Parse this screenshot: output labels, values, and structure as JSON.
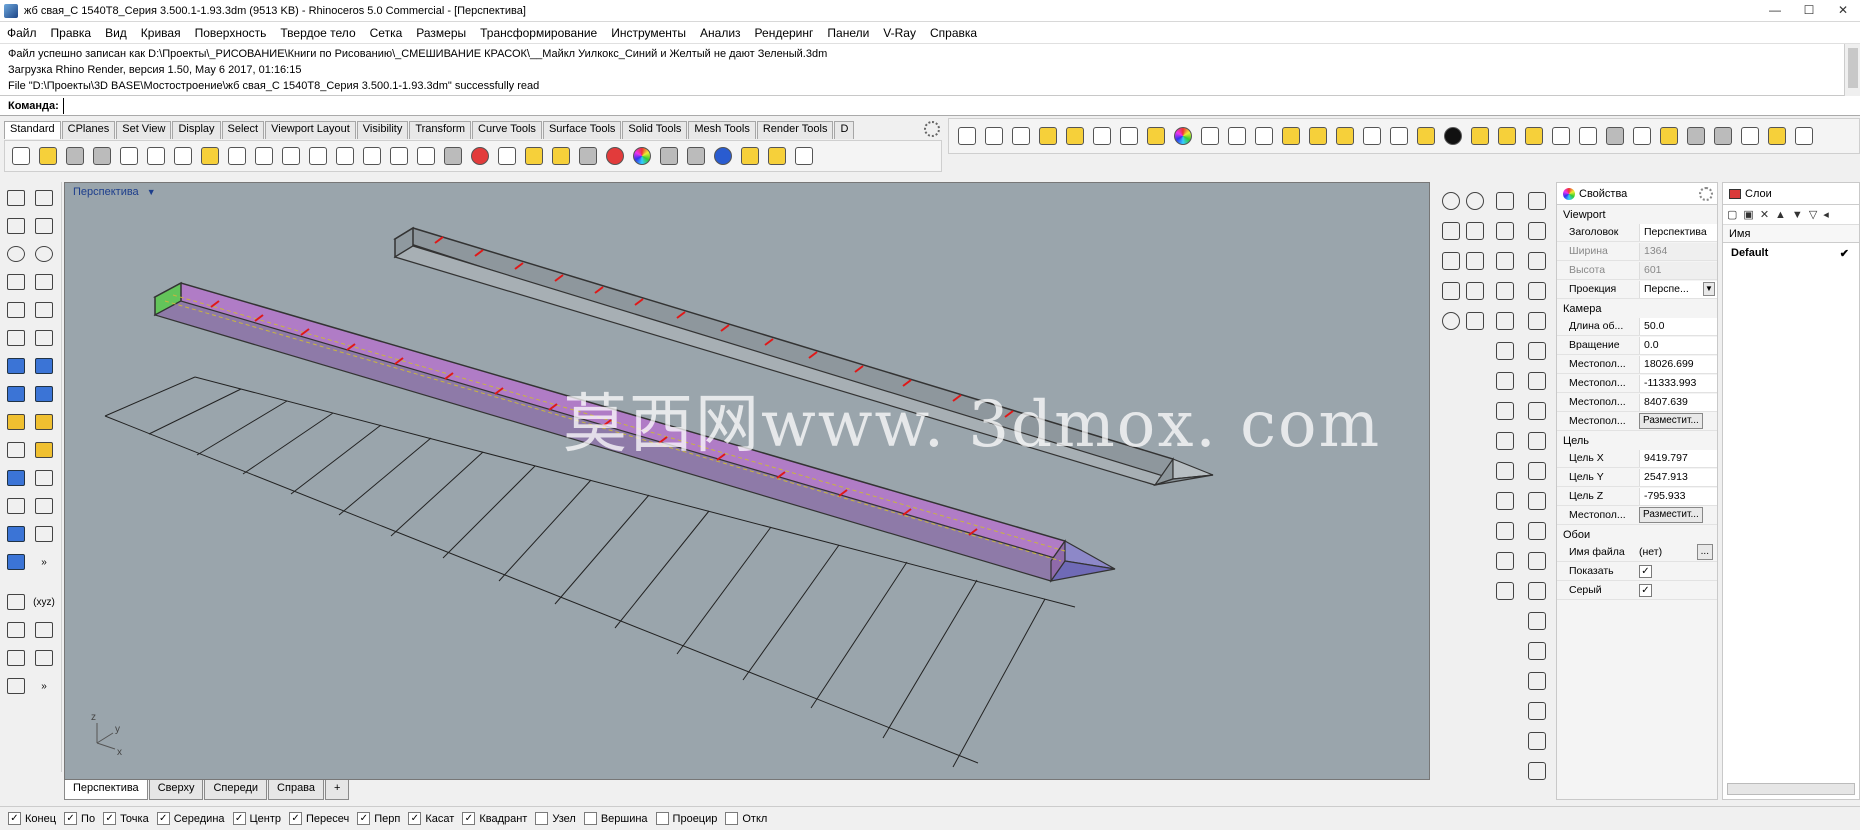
{
  "window": {
    "title": "жб свая_С 1540Т8_Серия 3.500.1-1.93.3dm (9513 KB) - Rhinoceros 5.0 Commercial - [Перспектива]",
    "controls": [
      "—",
      "☐",
      "✕"
    ]
  },
  "menu": [
    "Файл",
    "Правка",
    "Вид",
    "Кривая",
    "Поверхность",
    "Твердое тело",
    "Сетка",
    "Размеры",
    "Трансформирование",
    "Инструменты",
    "Анализ",
    "Рендеринг",
    "Панели",
    "V-Ray",
    "Справка"
  ],
  "history": [
    "Файл успешно записан как D:\\Проекты\\_РИСОВАНИЕ\\Книги по Рисованию\\_СМЕШИВАНИЕ КРАСОК\\__Майкл Уилкокс_Синий и Желтый не дают Зеленый.3dm",
    "Загрузка Rhino Render, версия 1.50, May  6 2017, 01:16:15",
    "File \"D:\\Проекты\\3D BASE\\Мостостроение\\жб свая_С 1540Т8_Серия 3.500.1-1.93.3dm\" successfully read"
  ],
  "command": {
    "label": "Команда:",
    "value": ""
  },
  "toolbar_tabs": [
    "Standard",
    "CPlanes",
    "Set View",
    "Display",
    "Select",
    "Viewport Layout",
    "Visibility",
    "Transform",
    "Curve Tools",
    "Surface Tools",
    "Solid Tools",
    "Mesh Tools",
    "Render Tools",
    "D"
  ],
  "viewport": {
    "label": "Перспектива",
    "axes": {
      "z": "z",
      "y": "y",
      "x": "x"
    },
    "watermark": "莫西网www. 3dmox. com"
  },
  "viewport_tabs": [
    "Перспектива",
    "Сверху",
    "Спереди",
    "Справа",
    "+"
  ],
  "osnaps": [
    {
      "label": "Конец",
      "checked": true
    },
    {
      "label": "По",
      "checked": true
    },
    {
      "label": "Точка",
      "checked": true
    },
    {
      "label": "Середина",
      "checked": true
    },
    {
      "label": "Центр",
      "checked": true
    },
    {
      "label": "Пересеч",
      "checked": true
    },
    {
      "label": "Перп",
      "checked": true
    },
    {
      "label": "Касат",
      "checked": true
    },
    {
      "label": "Квадрант",
      "checked": true
    },
    {
      "label": "Узел",
      "checked": false
    },
    {
      "label": "Вершина",
      "checked": false
    },
    {
      "label": "Проецир",
      "checked": false
    },
    {
      "label": "Откл",
      "checked": false
    }
  ],
  "properties": {
    "tab": "Свойства",
    "viewport_section": "Viewport",
    "title_label": "Заголовок",
    "title_value": "Перспектива",
    "width_label": "Ширина",
    "width_value": "1364",
    "height_label": "Высота",
    "height_value": "601",
    "projection_label": "Проекция",
    "projection_value": "Перспе...",
    "camera_section": "Камера",
    "lens_label": "Длина об...",
    "lens_value": "50.0",
    "rotation_label": "Вращение",
    "rotation_value": "0.0",
    "locx_label": "Местопол...",
    "locx_value": "18026.699",
    "locy_label": "Местопол...",
    "locy_value": "-11333.993",
    "locz_label": "Местопол...",
    "locz_value": "8407.639",
    "loc_label": "Местопол...",
    "place_button": "Разместит...",
    "target_section": "Цель",
    "tx_label": "Цель X",
    "tx_value": "9419.797",
    "ty_label": "Цель Y",
    "ty_value": "2547.913",
    "tz_label": "Цель Z",
    "tz_value": "-795.933",
    "tloc_label": "Местопол...",
    "tplace_button": "Разместит...",
    "wallpaper_section": "Обои",
    "filename_label": "Имя файла",
    "filename_value": "(нет)",
    "browse_button": "...",
    "show_label": "Показать",
    "show_checked": "✓",
    "grey_label": "Серый",
    "grey_checked": "✓"
  },
  "layers": {
    "tab": "Слои",
    "column": "Имя",
    "rows": [
      {
        "name": "Default",
        "current": "✔"
      }
    ]
  }
}
